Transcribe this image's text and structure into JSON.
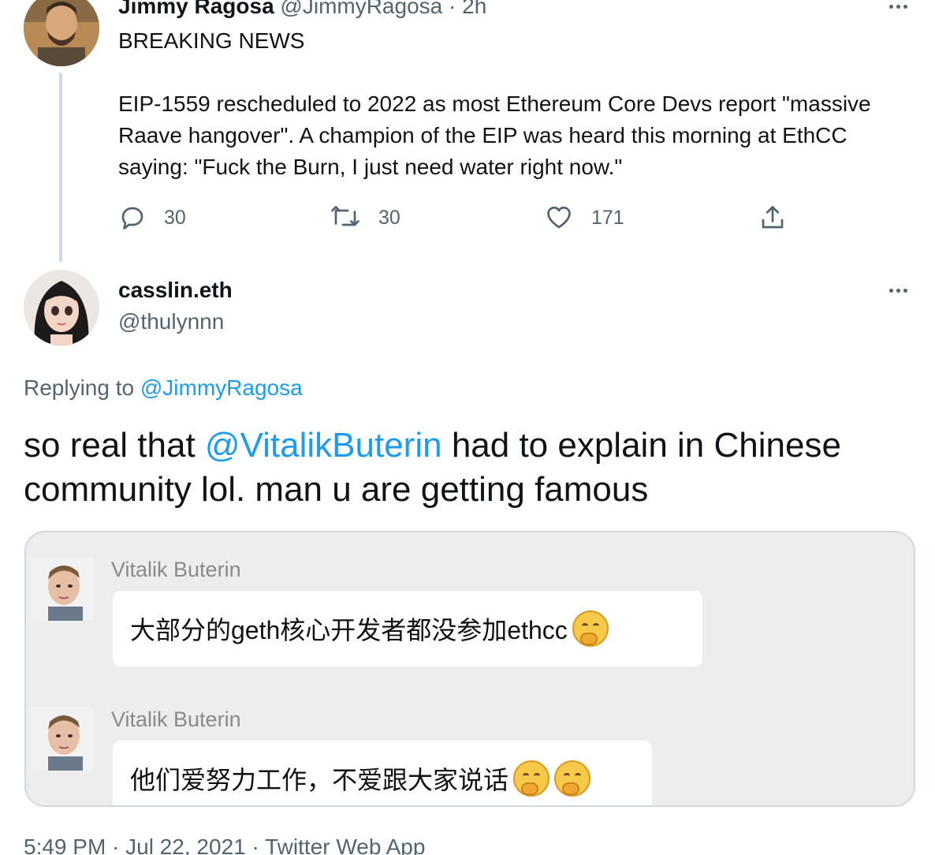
{
  "parent_tweet": {
    "name": "Jimmy Ragosa",
    "handle": "@JimmyRagosa",
    "separator": "·",
    "time": "2h",
    "line1": "BREAKING NEWS",
    "body_line1": "EIP-1559 rescheduled to 2022 as most Ethereum Core Devs report \"massive",
    "body_line2": "Raave hangover\". A champion of the EIP was heard this morning at EthCC",
    "body_line3": "saying: \"Fuck the Burn, I just need water right now.\"",
    "reply_count": "30",
    "retweet_count": "30",
    "like_count": "171"
  },
  "main_tweet": {
    "name": "casslin.eth",
    "handle": "@thulynnn",
    "replying_prefix": "Replying to",
    "replying_to": "@JimmyRagosa",
    "text_before_mention": "so real that",
    "mention": "@VitalikButerin",
    "text_after_mention": "had to explain in Chinese",
    "text_line2": "community lol. man u are getting famous",
    "timestamp": "5:49 PM · Jul 22, 2021 · Twitter Web App"
  },
  "chat": {
    "messages": [
      {
        "sender": "Vitalik Buterin",
        "text": "大部分的geth核心开发者都没参加ethcc",
        "emoji_count": 1
      },
      {
        "sender": "Vitalik Buterin",
        "text": "他们爱努力工作，不爱跟大家说话",
        "emoji_count": 2
      }
    ]
  },
  "icons": {
    "reply": "reply-icon",
    "retweet": "retweet-icon",
    "like": "heart-icon",
    "share": "share-icon",
    "more": "more-icon",
    "emoji": "thinking-face-emoji"
  },
  "colors": {
    "link": "#1d9bf0",
    "muted": "#536471",
    "text": "#0f1419",
    "chat_background": "#ededed"
  }
}
